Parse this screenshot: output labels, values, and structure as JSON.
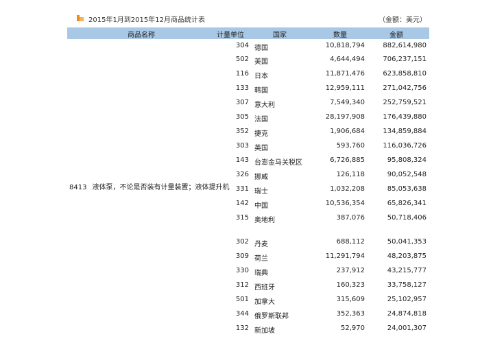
{
  "report": {
    "title": "2015年1月到2015年12月商品统计表",
    "unit_note": "（金额：美元）"
  },
  "headers": {
    "name": "商品名称",
    "unit": "计量单位",
    "country": "国家",
    "quantity": "数量",
    "amount": "金额"
  },
  "product": {
    "code": "8413",
    "name": "液体泵，不论是否装有计量装置；液体提升机"
  },
  "rows": [
    {
      "code": "304",
      "country": "德国",
      "quantity": "10,818,794",
      "amount": "882,614,980"
    },
    {
      "code": "502",
      "country": "美国",
      "quantity": "4,644,494",
      "amount": "706,237,151"
    },
    {
      "code": "116",
      "country": "日本",
      "quantity": "11,871,476",
      "amount": "623,858,810"
    },
    {
      "code": "133",
      "country": "韩国",
      "quantity": "12,959,111",
      "amount": "271,042,756"
    },
    {
      "code": "307",
      "country": "意大利",
      "quantity": "7,549,340",
      "amount": "252,759,521"
    },
    {
      "code": "305",
      "country": "法国",
      "quantity": "28,197,908",
      "amount": "176,439,880"
    },
    {
      "code": "352",
      "country": "捷克",
      "quantity": "1,906,684",
      "amount": "134,859,884"
    },
    {
      "code": "303",
      "country": "英国",
      "quantity": "593,760",
      "amount": "116,036,726"
    },
    {
      "code": "143",
      "country": "台澎金马关税区",
      "quantity": "6,726,885",
      "amount": "95,808,324"
    },
    {
      "code": "326",
      "country": "挪威",
      "quantity": "126,118",
      "amount": "90,052,548"
    },
    {
      "code": "331",
      "country": "瑞士",
      "quantity": "1,032,208",
      "amount": "85,053,638"
    },
    {
      "code": "142",
      "country": "中国",
      "quantity": "10,536,354",
      "amount": "65,826,341"
    },
    {
      "code": "315",
      "country": "奥地利",
      "quantity": "387,076",
      "amount": "50,718,406"
    },
    {
      "code": "302",
      "country": "丹麦",
      "quantity": "688,112",
      "amount": "50,041,353"
    },
    {
      "code": "309",
      "country": "荷兰",
      "quantity": "11,291,794",
      "amount": "48,203,875"
    },
    {
      "code": "330",
      "country": "瑞典",
      "quantity": "237,912",
      "amount": "43,215,777"
    },
    {
      "code": "312",
      "country": "西班牙",
      "quantity": "160,323",
      "amount": "33,758,127"
    },
    {
      "code": "501",
      "country": "加拿大",
      "quantity": "315,609",
      "amount": "25,102,957"
    },
    {
      "code": "344",
      "country": "俄罗斯联邦",
      "quantity": "352,363",
      "amount": "24,874,818"
    },
    {
      "code": "132",
      "country": "新加坡",
      "quantity": "52,970",
      "amount": "24,001,307"
    }
  ]
}
